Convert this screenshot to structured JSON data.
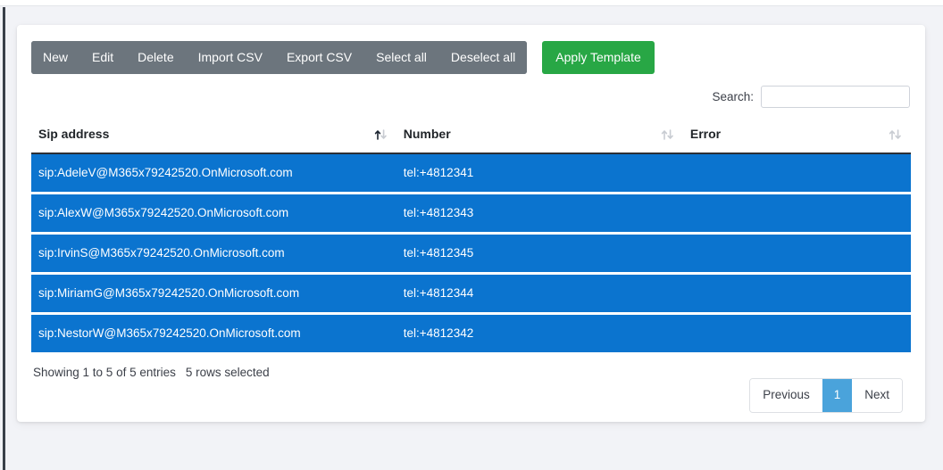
{
  "toolbar": {
    "buttons": [
      {
        "label": "New",
        "name": "new-button"
      },
      {
        "label": "Edit",
        "name": "edit-button"
      },
      {
        "label": "Delete",
        "name": "delete-button"
      },
      {
        "label": "Import CSV",
        "name": "import-csv-button"
      },
      {
        "label": "Export CSV",
        "name": "export-csv-button"
      },
      {
        "label": "Select all",
        "name": "select-all-button"
      },
      {
        "label": "Deselect all",
        "name": "deselect-all-button"
      }
    ],
    "apply_template_label": "Apply Template",
    "group_color": "#6c757d",
    "apply_template_color": "#28a745"
  },
  "search": {
    "label": "Search:",
    "value": "",
    "placeholder": ""
  },
  "table": {
    "columns": [
      {
        "label": "Sip address",
        "sort": "asc"
      },
      {
        "label": "Number",
        "sort": "none"
      },
      {
        "label": "Error",
        "sort": "none"
      }
    ],
    "rows": [
      {
        "sip": "sip:AdeleV@M365x79242520.OnMicrosoft.com",
        "number": "tel:+4812341",
        "error": ""
      },
      {
        "sip": "sip:AlexW@M365x79242520.OnMicrosoft.com",
        "number": "tel:+4812343",
        "error": ""
      },
      {
        "sip": "sip:IrvinS@M365x79242520.OnMicrosoft.com",
        "number": "tel:+4812345",
        "error": ""
      },
      {
        "sip": "sip:MiriamG@M365x79242520.OnMicrosoft.com",
        "number": "tel:+4812344",
        "error": ""
      },
      {
        "sip": "sip:NestorW@M365x79242520.OnMicrosoft.com",
        "number": "tel:+4812342",
        "error": ""
      }
    ],
    "row_selected_color": "#0b74cf"
  },
  "footer": {
    "info": "Showing 1 to 5 of 5 entries",
    "rows_selected": "5 rows selected",
    "pagination": {
      "previous_label": "Previous",
      "next_label": "Next",
      "pages": [
        "1"
      ],
      "current_page": "1",
      "active_color": "#4aa3db"
    }
  }
}
